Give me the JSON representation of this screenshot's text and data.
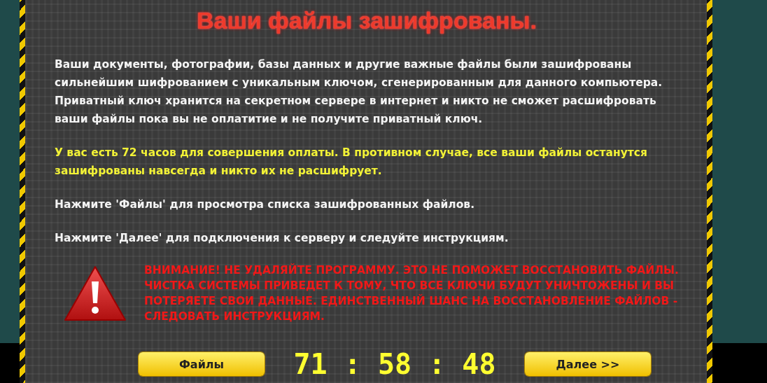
{
  "title": "Ваши файлы зашифрованы.",
  "paragraphs": [
    {
      "text": "Ваши документы, фотографии, базы данных и другие важные файлы были зашифрованы сильнейшим шифрованием с уникальным ключом, сгенерированным для данного компьютера. Приватный ключ хранится на секретном сервере в интернет и никто не сможет расшифровать ваши файлы пока вы не оплатитие и не получите приватный ключ.",
      "kind": "normal"
    },
    {
      "text": "У вас есть 72 часов для совершения оплаты. В противном случае, все ваши файлы останутся зашифрованы навсегда и никто их не расшифрует.",
      "kind": "highlight"
    },
    {
      "text": "Нажмите 'Файлы' для просмотра списка зашифрованных файлов.",
      "kind": "normal"
    },
    {
      "text": "Нажмите 'Далее' для подключения к серверу и следуйте инструкциям.",
      "kind": "normal"
    }
  ],
  "warning": "ВНИМАНИЕ! НЕ УДАЛЯЙТЕ ПРОГРАММУ. ЭТО НЕ ПОМОЖЕТ ВОССТАНОВИТЬ ФАЙЛЫ. ЧИСТКА СИСТЕМЫ ПРИВЕДЕТ К ТОМУ, ЧТО ВСЕ КЛЮЧИ БУДУТ УНИЧТОЖЕНЫ И ВЫ ПОТЕРЯЕТЕ СВОИ ДАННЫЕ. ЕДИНСТВЕННЫЙ ШАНС НА ВОССТАНОВЛЕНИЕ ФАЙЛОВ - СЛЕДОВАТЬ ИНСТРУКЦИЯМ.",
  "files_button": "Файлы",
  "timer": "71 : 58 : 48",
  "next_button": "Далее >>"
}
